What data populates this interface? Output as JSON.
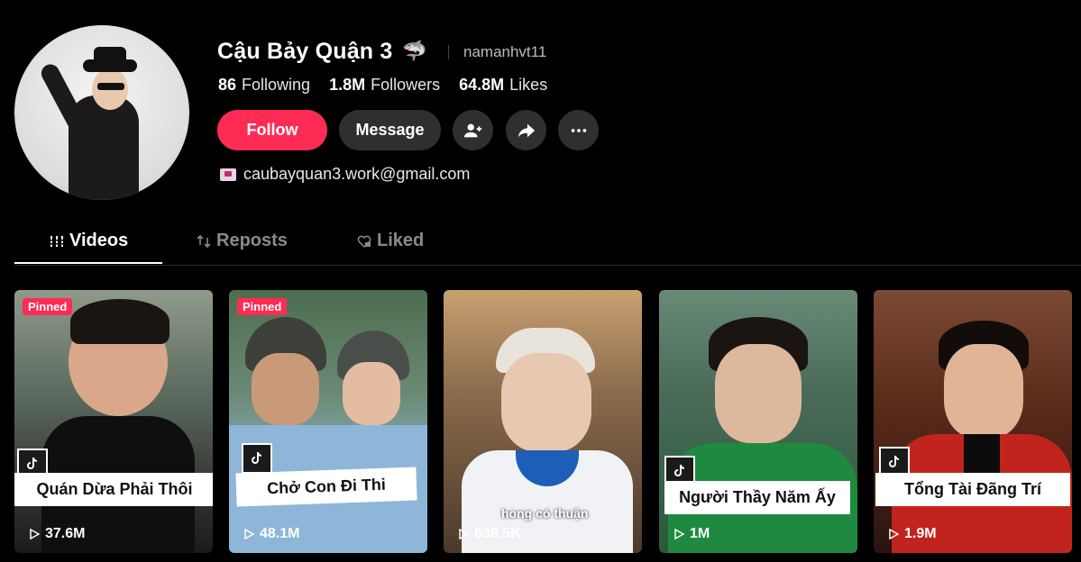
{
  "profile": {
    "display_name": "Cậu Bảy Quận 3",
    "name_emoji": "🦈",
    "username": "namanhvt11",
    "following_count": "86",
    "following_label": "Following",
    "followers_count": "1.8M",
    "followers_label": "Followers",
    "likes_count": "64.8M",
    "likes_label": "Likes",
    "email": "caubayquan3.work@gmail.com"
  },
  "actions": {
    "follow_label": "Follow",
    "message_label": "Message"
  },
  "tabs": [
    {
      "label": "Videos",
      "icon": "grid-icon",
      "active": true
    },
    {
      "label": "Reposts",
      "icon": "repost-icon",
      "active": false
    },
    {
      "label": "Liked",
      "icon": "heart-lock-icon",
      "active": false
    }
  ],
  "videos": [
    {
      "pinned_label": "Pinned",
      "caption": "Quán Dừa Phải Thôi",
      "views": "37.6M"
    },
    {
      "pinned_label": "Pinned",
      "caption": "Chở Con Đi Thi",
      "views": "48.1M"
    },
    {
      "caption": "",
      "subtitle": "hong có thuận",
      "views": "638.5K"
    },
    {
      "caption": "Người Thầy Năm Ấy",
      "views": "1M"
    },
    {
      "caption": "Tổng Tài Đãng Trí",
      "views": "1.9M"
    }
  ],
  "colors": {
    "accent": "#fe2c55",
    "background": "#000000",
    "button_dark": "#2f2f2f"
  }
}
